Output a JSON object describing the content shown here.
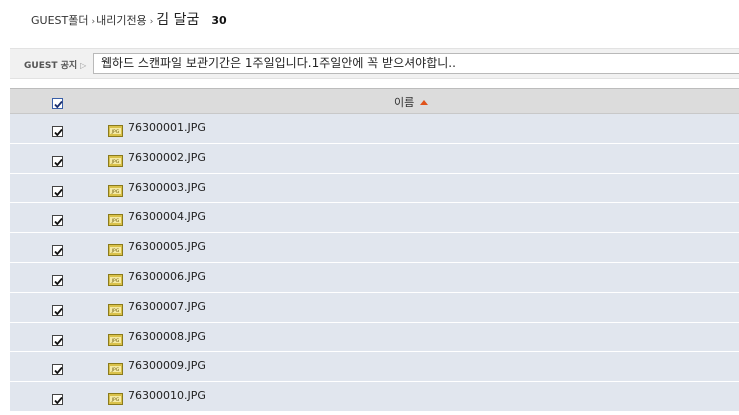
{
  "breadcrumb": {
    "root": "GUEST폴더",
    "sep": "›",
    "folder": "내리기전용",
    "current": "김 달굼",
    "count": "30"
  },
  "notice": {
    "label": "GUEST 공지",
    "text": "웹하드 스캔파일 보관기간은 1주일입니다.1주일안에 꼭 받으셔야합니.."
  },
  "table": {
    "header": {
      "name": "이름",
      "select_all_checked": true
    },
    "rows": [
      {
        "name": "76300001.JPG",
        "checked": true
      },
      {
        "name": "76300002.JPG",
        "checked": true
      },
      {
        "name": "76300003.JPG",
        "checked": true
      },
      {
        "name": "76300004.JPG",
        "checked": true
      },
      {
        "name": "76300005.JPG",
        "checked": true
      },
      {
        "name": "76300006.JPG",
        "checked": true
      },
      {
        "name": "76300007.JPG",
        "checked": true
      },
      {
        "name": "76300008.JPG",
        "checked": true
      },
      {
        "name": "76300009.JPG",
        "checked": true
      },
      {
        "name": "76300010.JPG",
        "checked": true
      }
    ]
  },
  "icons": {
    "file": "jpg-file-icon",
    "sort": "sort-ascending-icon",
    "check": "checkbox-checked-icon"
  },
  "colors": {
    "row_bg": "#e1e6ee",
    "header_bg": "#dcdcdc",
    "sort_arrow": "#e0531b"
  }
}
